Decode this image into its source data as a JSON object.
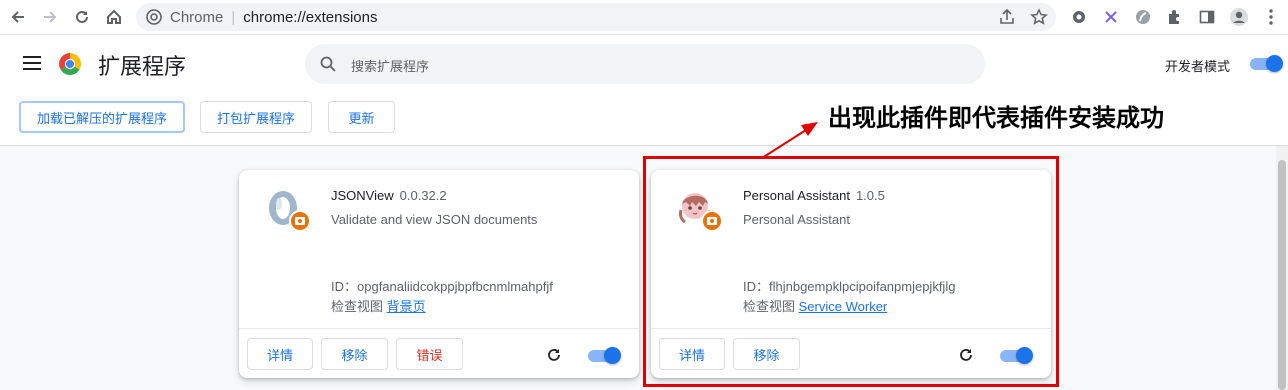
{
  "browser": {
    "omnibox_site": "Chrome",
    "omnibox_url": "chrome://extensions"
  },
  "header": {
    "title": "扩展程序",
    "search_placeholder": "搜索扩展程序",
    "dev_mode_label": "开发者模式",
    "dev_mode_on": true
  },
  "actions": {
    "load_unpacked": "加载已解压的扩展程序",
    "pack": "打包扩展程序",
    "update": "更新"
  },
  "extensions": [
    {
      "name": "JSONView",
      "version": "0.0.32.2",
      "description": "Validate and view JSON documents",
      "id_line": "ID：opgfanaliidcokppjbpfbcnmlmahpfjf",
      "inspect_label": "检查视图",
      "inspect_link": "背景页",
      "details": "详情",
      "remove": "移除",
      "errors": "错误",
      "enabled": true
    },
    {
      "name": "Personal Assistant",
      "version": "1.0.5",
      "description": "Personal Assistant",
      "id_line": "ID：flhjnbgempklpcipoifanpmjepjkfjlg",
      "inspect_label": "检查视图",
      "inspect_link": "Service Worker",
      "details": "详情",
      "remove": "移除",
      "enabled": true
    }
  ],
  "annotation": {
    "text": "出现此插件即代表插件安装成功",
    "color": "#e00000"
  }
}
